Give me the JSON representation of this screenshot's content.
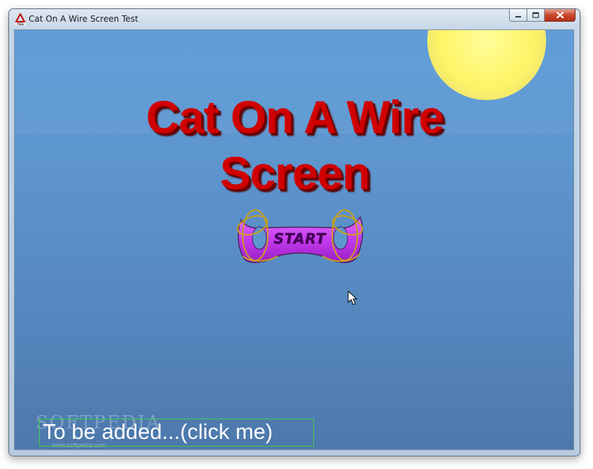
{
  "window": {
    "title": "Cat On A Wire Screen Test",
    "icon": "ygg-app-icon",
    "controls": {
      "minimize": "minimize-icon",
      "maximize": "maximize-icon",
      "close": "close-icon"
    }
  },
  "game": {
    "title_line1": "Cat On A Wire",
    "title_line2": "Screen",
    "start_label": "START",
    "bottom_button": "To be added...(click me)",
    "watermark": "SOFTPEDIA",
    "watermark_url": "www.softpedia.com"
  },
  "colors": {
    "sky": "#5a90cc",
    "sun": "#fff466",
    "title_red": "#d00000",
    "start_purple": "#c83cf0",
    "wire_gold": "#c8a020",
    "button_border": "#3fd04a"
  }
}
